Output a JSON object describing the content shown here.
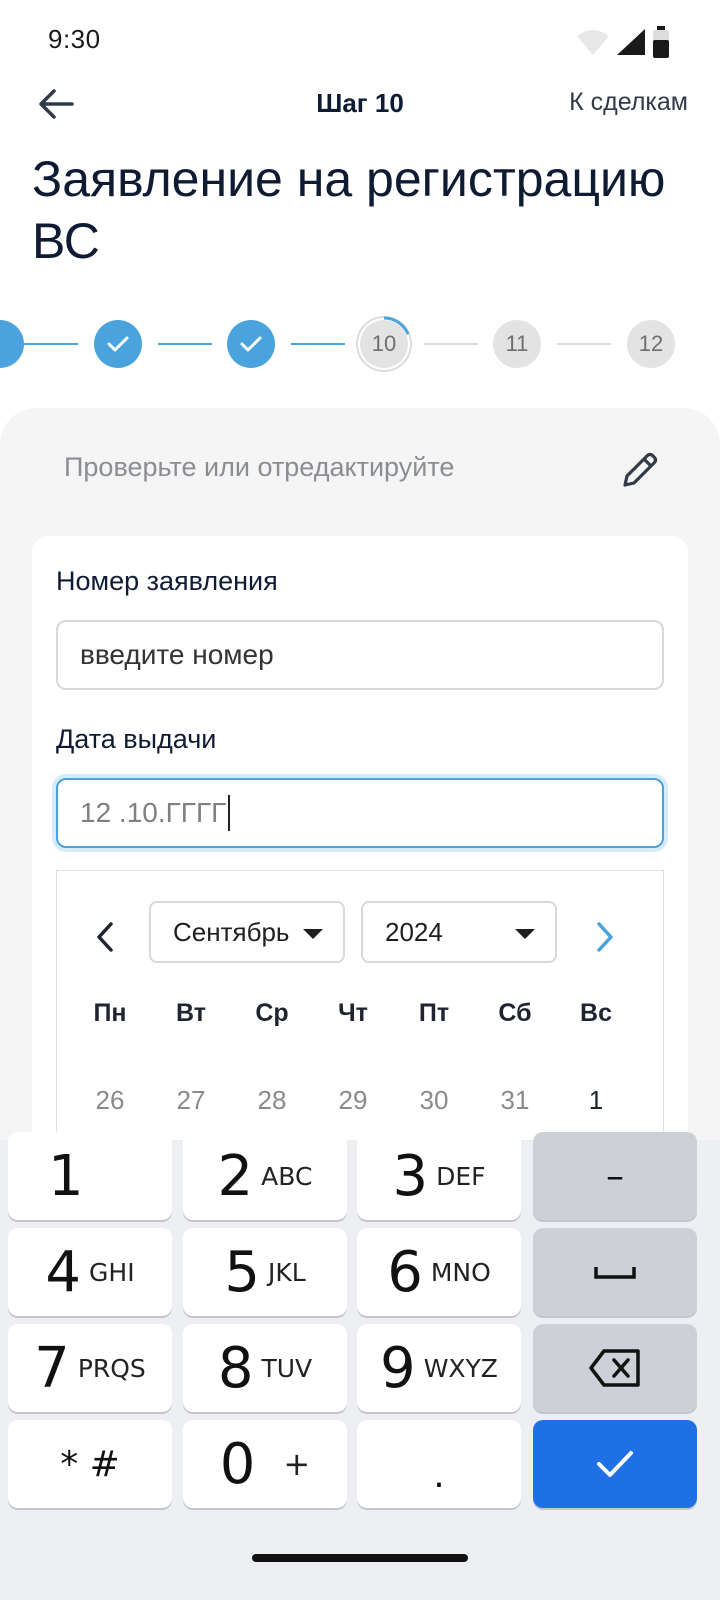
{
  "status_bar": {
    "time": "9:30"
  },
  "header": {
    "step_title": "Шаг 10",
    "deals_link": "К сделкам",
    "page_title": "Заявление на регистрацию ВС"
  },
  "stepper": {
    "steps": [
      {
        "state": "done"
      },
      {
        "state": "done"
      },
      {
        "state": "done"
      },
      {
        "label": "10",
        "state": "current"
      },
      {
        "label": "11",
        "state": "pending"
      },
      {
        "label": "12",
        "state": "pending"
      }
    ]
  },
  "panel": {
    "hint": "Проверьте или отредактируйте"
  },
  "form": {
    "number_label": "Номер заявления",
    "number_placeholder": "введите номер",
    "date_label": "Дата выдачи",
    "date_value": "12 .10.ГГГГ"
  },
  "calendar": {
    "month": "Сентябрь",
    "year": "2024",
    "weekdays": [
      "Пн",
      "Вт",
      "Ср",
      "Чт",
      "Пт",
      "Сб",
      "Вс"
    ],
    "first_row": [
      "26",
      "27",
      "28",
      "29",
      "30",
      "31",
      "1"
    ]
  },
  "keyboard": {
    "keys": [
      {
        "num": "1",
        "letters": ""
      },
      {
        "num": "2",
        "letters": "ABC"
      },
      {
        "num": "3",
        "letters": "DEF"
      },
      {
        "num": "4",
        "letters": "GHI"
      },
      {
        "num": "5",
        "letters": "JKL"
      },
      {
        "num": "6",
        "letters": "MNO"
      },
      {
        "num": "7",
        "letters": "PRQS"
      },
      {
        "num": "8",
        "letters": "TUV"
      },
      {
        "num": "9",
        "letters": "WXYZ"
      },
      {
        "num": "0",
        "letters": "+"
      }
    ],
    "star_hash": "* #",
    "dot": ".",
    "minus": "–"
  },
  "colors": {
    "accent": "#4aa3dc",
    "enter_key": "#1f6fe5",
    "title": "#0f1b33"
  }
}
